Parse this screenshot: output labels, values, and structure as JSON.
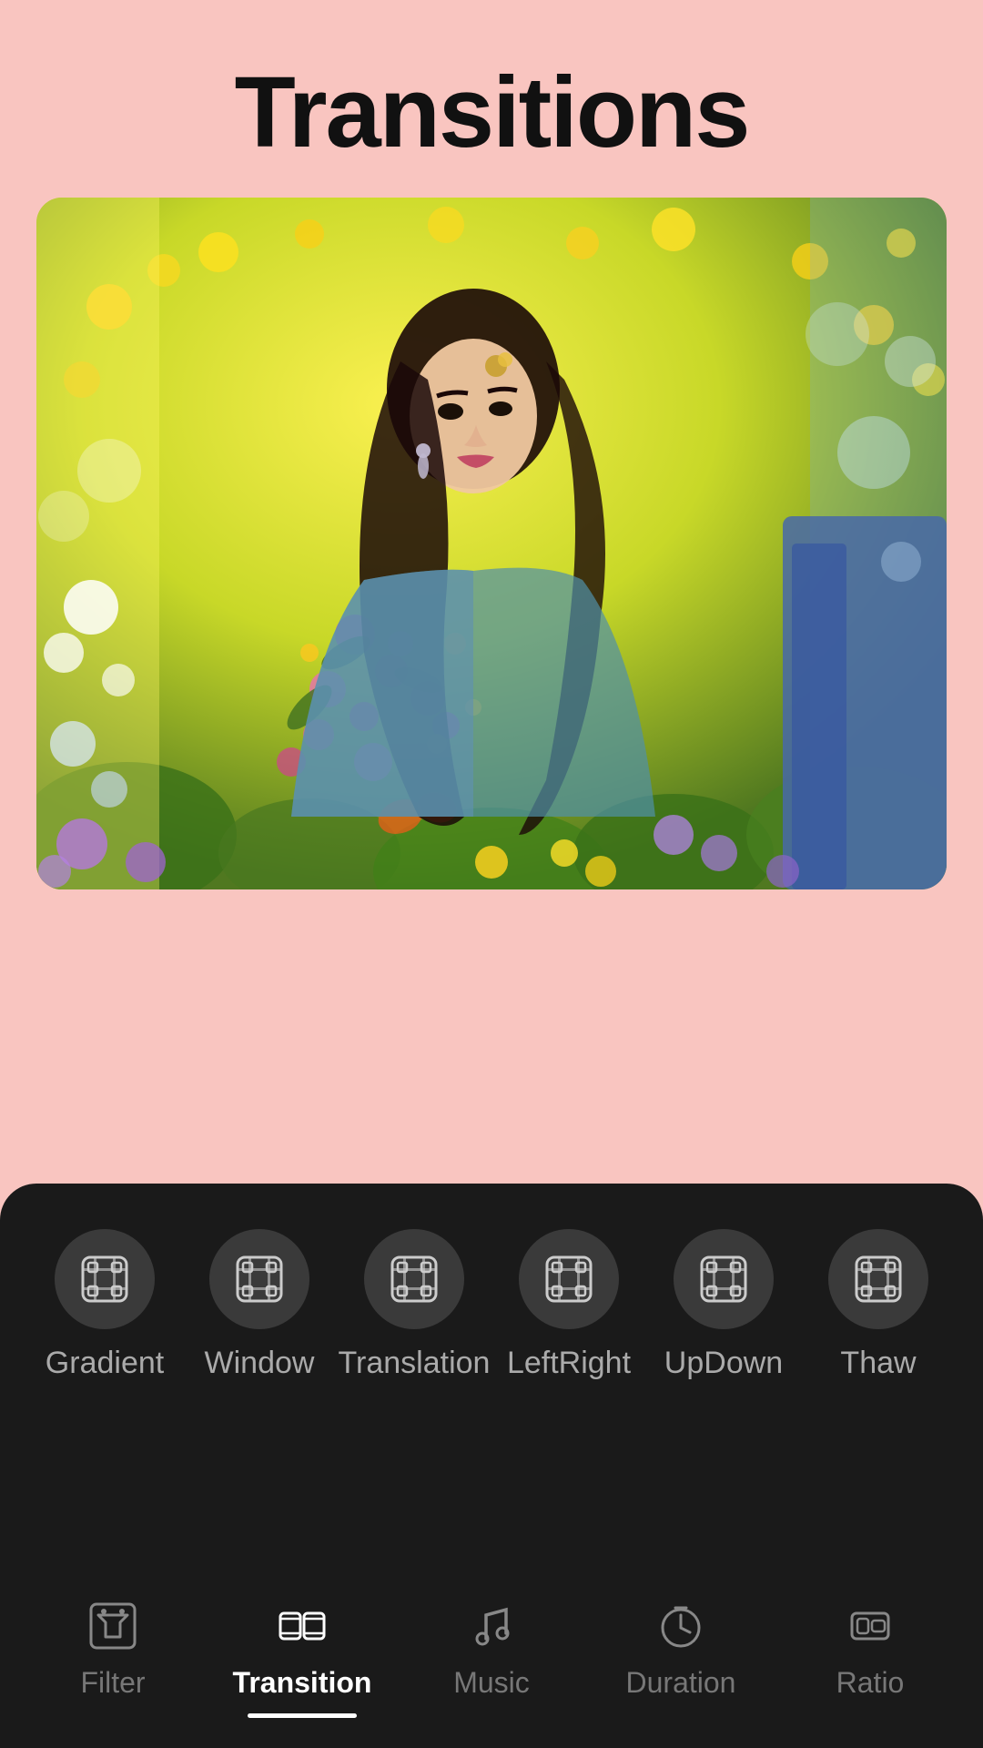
{
  "page": {
    "title": "Transitions",
    "background_color": "#f9c5c0"
  },
  "transitions": {
    "items": [
      {
        "id": "gradient",
        "label": "Gradient",
        "active": false
      },
      {
        "id": "window",
        "label": "Window",
        "active": false
      },
      {
        "id": "translation",
        "label": "Translation",
        "active": false
      },
      {
        "id": "leftright",
        "label": "LeftRight",
        "active": false
      },
      {
        "id": "updown",
        "label": "UpDown",
        "active": false
      },
      {
        "id": "thaw",
        "label": "Thaw",
        "active": false
      }
    ]
  },
  "bottom_nav": {
    "items": [
      {
        "id": "filter",
        "label": "Filter",
        "active": false
      },
      {
        "id": "transition",
        "label": "Transition",
        "active": true
      },
      {
        "id": "music",
        "label": "Music",
        "active": false
      },
      {
        "id": "duration",
        "label": "Duration",
        "active": false
      },
      {
        "id": "ratio",
        "label": "Ratio",
        "active": false
      }
    ]
  }
}
